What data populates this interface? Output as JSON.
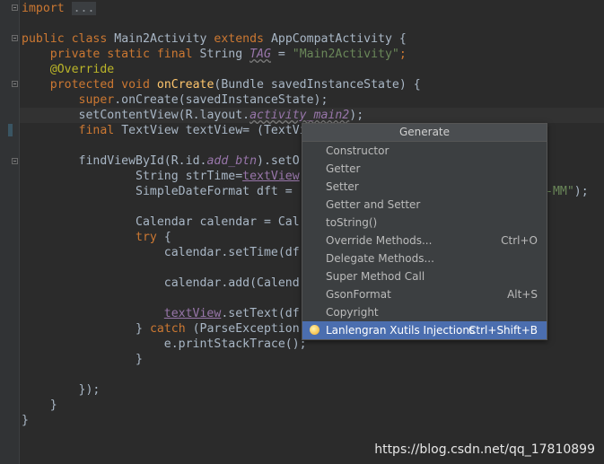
{
  "code": {
    "import_keyword": "import",
    "import_fold": "...",
    "class_decl": {
      "public": "public",
      "class": "class",
      "name": "Main2Activity",
      "extends": "extends",
      "parent": "AppCompatActivity",
      "brace": " {"
    },
    "tag_line": {
      "mods": "private static final",
      "type": "String",
      "field": "TAG",
      "eq": " = ",
      "value": "\"Main2Activity\"",
      "semi": ";"
    },
    "override": "@Override",
    "oncreate_decl": {
      "mods": "protected void",
      "name": "onCreate",
      "params": "(Bundle savedInstanceState) {"
    },
    "super_line": {
      "super": "super",
      "call": ".onCreate(savedInstanceState);"
    },
    "setcontent_line": {
      "call": "setContentView(R.layout.",
      "field": "activity_main2",
      "end": ");"
    },
    "textview_line": {
      "final": "final",
      "rest": "TextView textView= (TextVie"
    },
    "findview_line": {
      "call": "findViewById(R.id.",
      "field": "add_btn",
      "end": ").setO"
    },
    "strtime_line": {
      "decl": "String strTime=",
      "var": "textView"
    },
    "sdf_line": {
      "decl": "SimpleDateFormat dft = ",
      "tail_str": "-MM\"",
      "tail_end": ");"
    },
    "calendar_line": "Calendar calendar = Cal",
    "try_kw": "try",
    "try_brace": " {",
    "settime_line": "calendar.setTime(df",
    "add_line": "calendar.add(Calend",
    "settext_line": {
      "var": "textView",
      "call": ".setText(df"
    },
    "catch_line": {
      "close": "} ",
      "catch": "catch",
      "rest": " (ParseException"
    },
    "stacktrace_line": "e.printStackTrace();",
    "close_brace_inner": "}",
    "close_call": "});",
    "close_method": "}",
    "close_class": "}"
  },
  "popup": {
    "title": "Generate",
    "items": [
      {
        "label": "Constructor",
        "shortcut": ""
      },
      {
        "label": "Getter",
        "shortcut": ""
      },
      {
        "label": "Setter",
        "shortcut": ""
      },
      {
        "label": "Getter and Setter",
        "shortcut": ""
      },
      {
        "label": "toString()",
        "shortcut": ""
      },
      {
        "label": "Override Methods...",
        "shortcut": "Ctrl+O"
      },
      {
        "label": "Delegate Methods...",
        "shortcut": ""
      },
      {
        "label": "Super Method Call",
        "shortcut": ""
      },
      {
        "label": "GsonFormat",
        "shortcut": "Alt+S"
      },
      {
        "label": "Copyright",
        "shortcut": ""
      },
      {
        "label": "Lanlengran Xutils Injections",
        "shortcut": "Ctrl+Shift+B",
        "icon": "plugin-icon",
        "selected": true
      }
    ]
  },
  "watermark": "https://blog.csdn.net/qq_17810899",
  "colors": {
    "background": "#2b2b2b",
    "keyword": "#cc7832",
    "string": "#6a8759",
    "method": "#ffc66d",
    "field": "#9876aa",
    "selection": "#4b6eaf"
  }
}
